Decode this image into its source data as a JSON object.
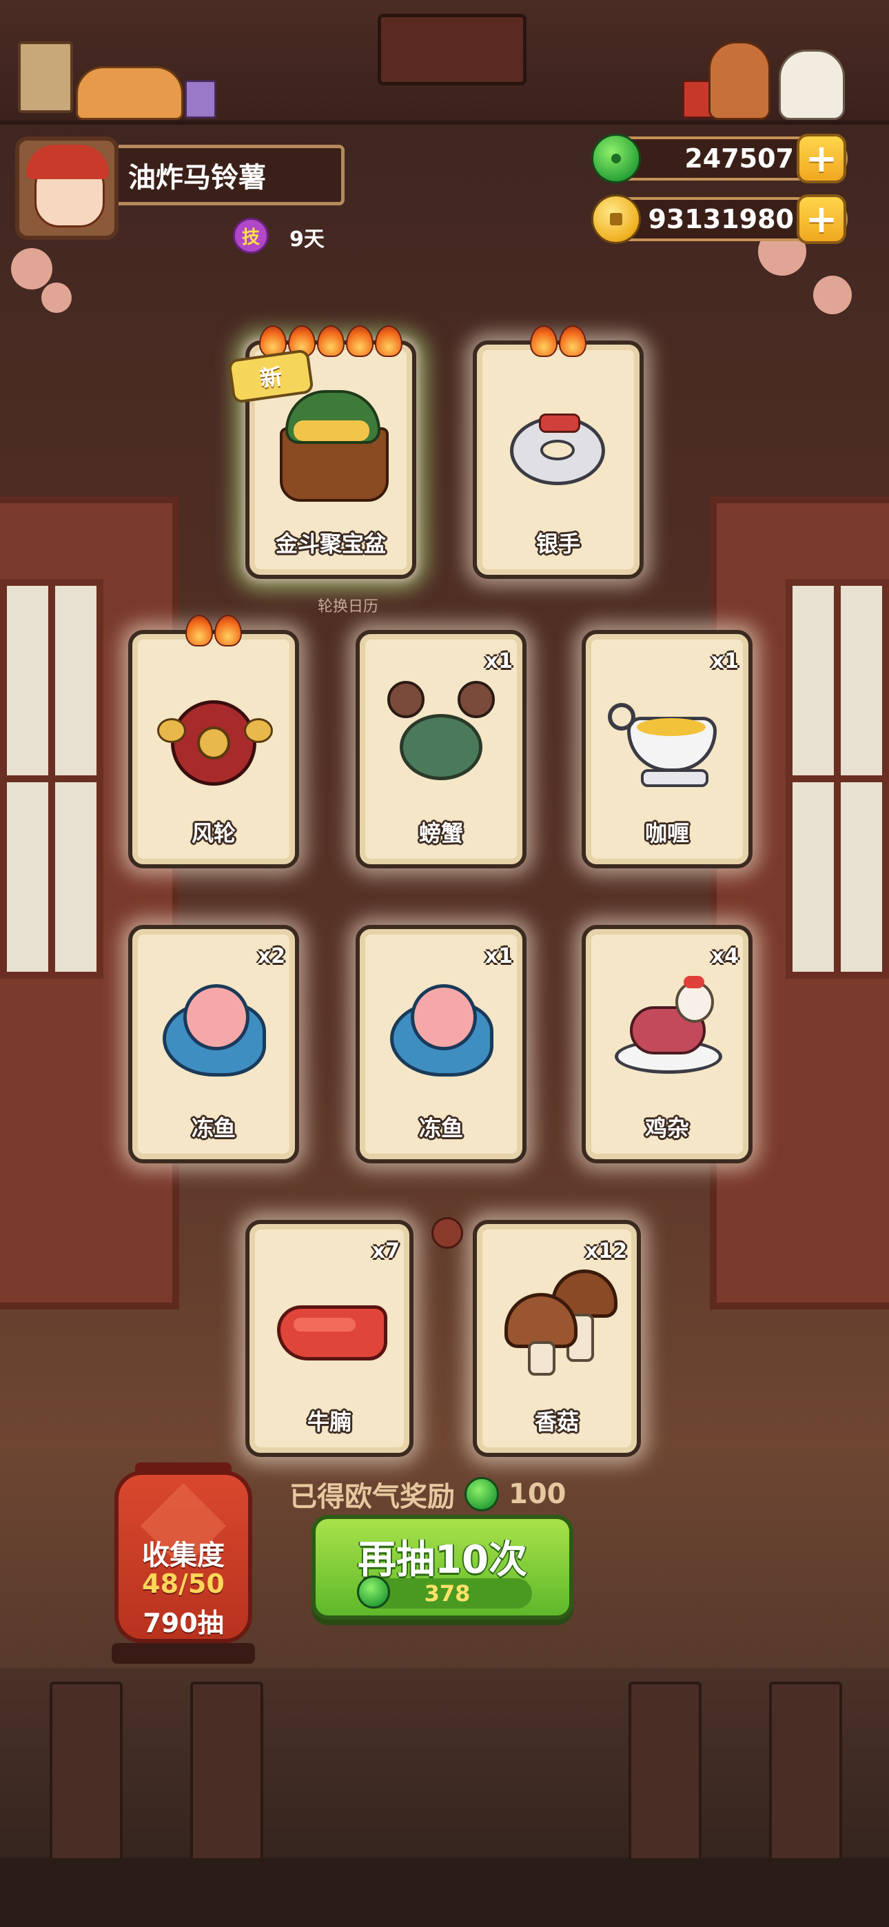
{
  "player": {
    "name": "油炸马铃薯",
    "skill_badge": "技",
    "days": "9天"
  },
  "currency": {
    "jade": "247507",
    "coins": "93131980"
  },
  "calendar_label": "轮换日历",
  "new_tag": "新",
  "cards": [
    {
      "name": "金斗聚宝盆",
      "qty": "",
      "flames": 5,
      "is_new": true,
      "icon": "treasure-bowl-icon"
    },
    {
      "name": "银手",
      "qty": "",
      "flames": 2,
      "is_new": false,
      "icon": "silver-ring-icon"
    },
    {
      "name": "风轮",
      "qty": "",
      "flames": 2,
      "is_new": false,
      "icon": "wind-wheel-icon"
    },
    {
      "name": "螃蟹",
      "qty": "x1",
      "flames": 0,
      "is_new": false,
      "icon": "crab-icon"
    },
    {
      "name": "咖喱",
      "qty": "x1",
      "flames": 0,
      "is_new": false,
      "icon": "curry-gravy-boat-icon"
    },
    {
      "name": "冻鱼",
      "qty": "x2",
      "flames": 0,
      "is_new": false,
      "icon": "frozen-fish-icon"
    },
    {
      "name": "冻鱼",
      "qty": "x1",
      "flames": 0,
      "is_new": false,
      "icon": "frozen-fish-icon"
    },
    {
      "name": "鸡杂",
      "qty": "x4",
      "flames": 0,
      "is_new": false,
      "icon": "chicken-giblets-icon"
    },
    {
      "name": "牛腩",
      "qty": "x7",
      "flames": 0,
      "is_new": false,
      "icon": "beef-brisket-icon"
    },
    {
      "name": "香菇",
      "qty": "x12",
      "flames": 0,
      "is_new": false,
      "icon": "mushroom-icon"
    }
  ],
  "reward": {
    "label": "已得欧气奖励",
    "value": "100"
  },
  "draw_button": {
    "label": "再抽10次",
    "cost": "378"
  },
  "collection": {
    "title": "收集度",
    "count": "48/50",
    "draws": "790抽"
  },
  "colors": {
    "accent_green": "#5eb82a",
    "gold": "#f0a820",
    "card_bg": "#f4e6c6"
  }
}
